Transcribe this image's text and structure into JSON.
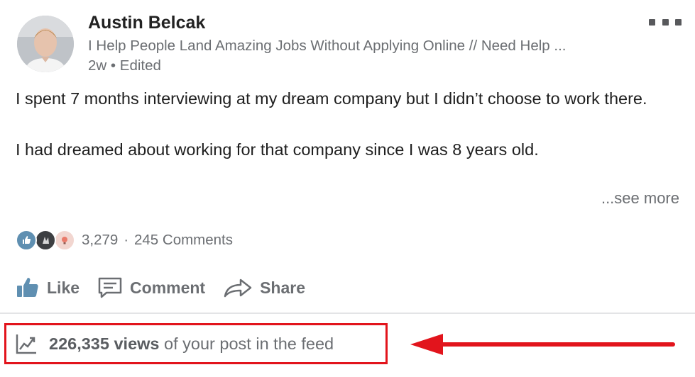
{
  "author": {
    "name": "Austin Belcak",
    "headline": "I Help People Land Amazing Jobs Without Applying Online // Need Help ...",
    "time": "2w",
    "edited": "Edited"
  },
  "post": {
    "paragraph_1": "I spent 7 months interviewing at my dream company but I didn’t choose to work there.",
    "paragraph_2": "I had dreamed about working for that company since I was 8 years old.",
    "see_more": "...see more"
  },
  "social": {
    "reaction_icons": [
      "like-icon",
      "celebrate-icon",
      "insightful-icon"
    ],
    "reactions_count": "3,279",
    "separator": "·",
    "comments": "245 Comments"
  },
  "actions": {
    "like": "Like",
    "comment": "Comment",
    "share": "Share"
  },
  "analytics": {
    "views_count": "226,335 views",
    "views_suffix": " of your post in the feed",
    "highlight_color": "#e2141c"
  }
}
